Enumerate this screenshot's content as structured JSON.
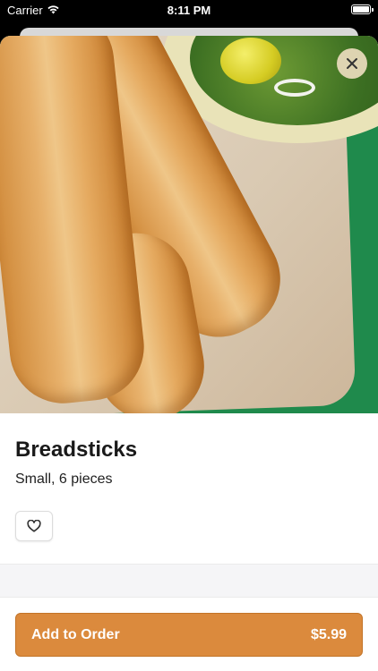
{
  "status_bar": {
    "carrier": "Carrier",
    "time": "8:11 PM"
  },
  "item": {
    "name": "Breadsticks",
    "description": "Small, 6 pieces"
  },
  "actions": {
    "add_label": "Add to Order",
    "price": "$5.99"
  },
  "icons": {
    "close": "close-icon",
    "favorite": "heart-icon",
    "wifi": "wifi-icon",
    "battery": "battery-icon"
  },
  "colors": {
    "accent": "#db8a3d"
  }
}
